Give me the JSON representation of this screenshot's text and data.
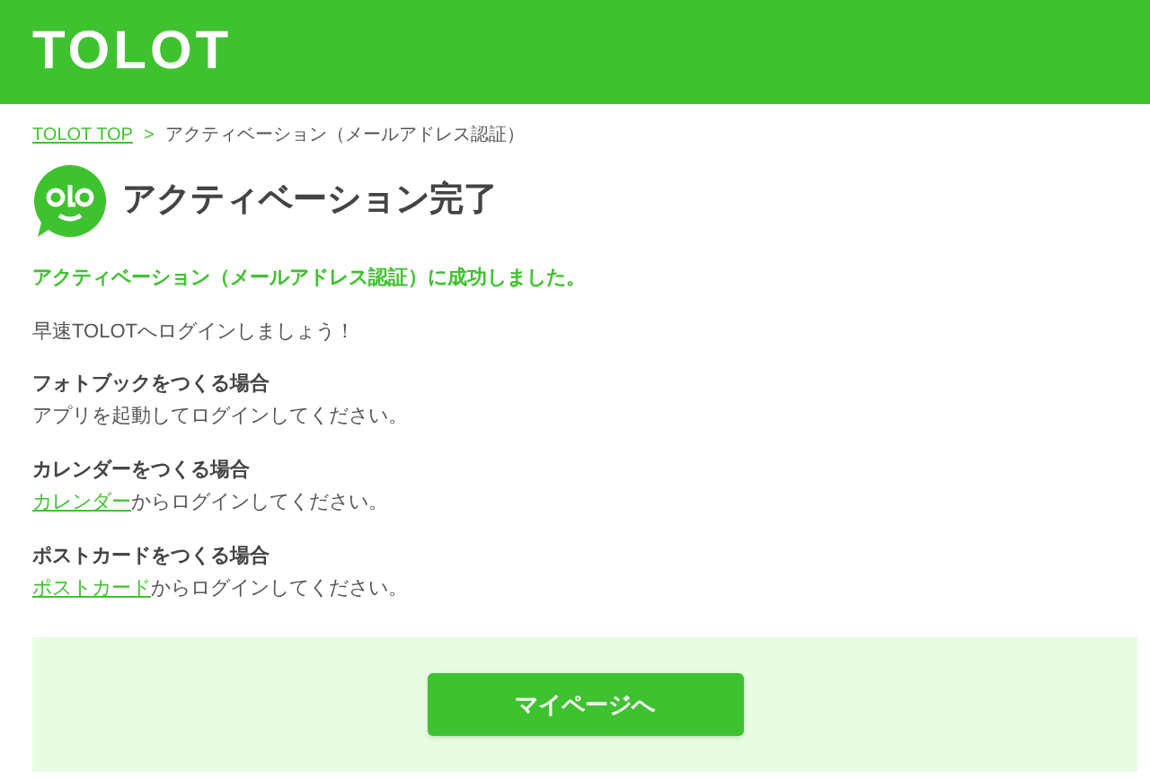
{
  "header": {
    "logo": "TOLOT"
  },
  "breadcrumb": [
    {
      "label": "TOLOT TOP",
      "kind": "link"
    },
    {
      "label": ">",
      "kind": "separator"
    },
    {
      "label": "アクティベーション（メールアドレス認証）",
      "kind": "current"
    }
  ],
  "title": "アクティベーション完了",
  "success_message": "アクティベーション（メールアドレス認証）に成功しました。",
  "intro": "早速TOLOTへログインしましょう！",
  "sections": [
    {
      "heading": "フォトブックをつくる場合",
      "text": "アプリを起動してログインしてください。"
    },
    {
      "heading": "カレンダーをつくる場合",
      "link": "カレンダー",
      "text": "からログインしてください。"
    },
    {
      "heading": "ポストカードをつくる場合",
      "link": "ポストカード",
      "text": "からログインしてください。"
    }
  ],
  "button": "マイページへ"
}
